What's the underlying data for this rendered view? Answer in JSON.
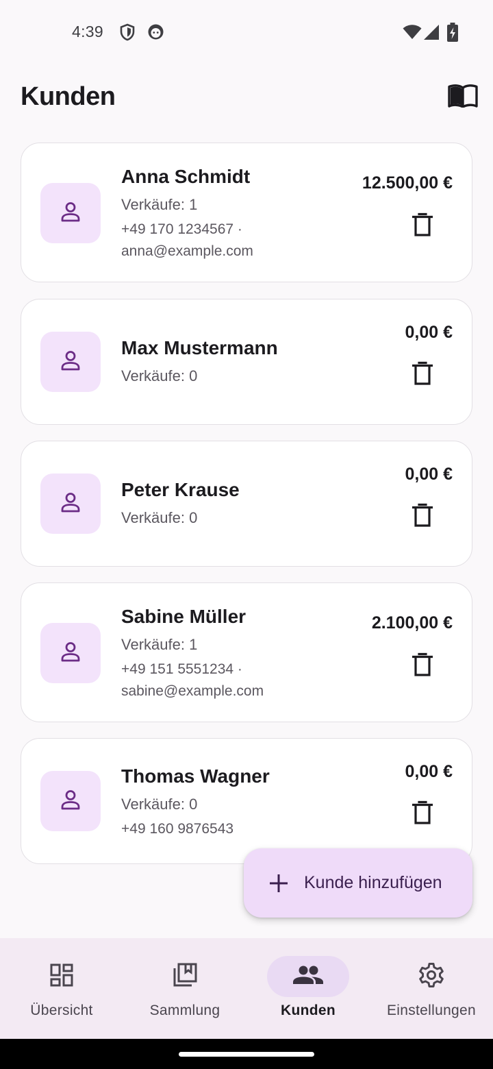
{
  "status_bar": {
    "time": "4:39",
    "left_icons": [
      "shield-icon",
      "face-icon"
    ],
    "right_icons": [
      "wifi-icon",
      "signal-icon",
      "battery-charging-icon"
    ]
  },
  "header": {
    "title": "Kunden",
    "action_icon": "book-icon"
  },
  "customers": [
    {
      "name": "Anna Schmidt",
      "sales": "Verkäufe: 1",
      "contact_line1": "+49 170 1234567 ·",
      "contact_line2": "anna@example.com",
      "amount": "12.500,00 €"
    },
    {
      "name": "Max Mustermann",
      "sales": "Verkäufe: 0",
      "contact_line1": "",
      "contact_line2": "",
      "amount": "0,00 €"
    },
    {
      "name": "Peter Krause",
      "sales": "Verkäufe: 0",
      "contact_line1": "",
      "contact_line2": "",
      "amount": "0,00 €"
    },
    {
      "name": "Sabine Müller",
      "sales": "Verkäufe: 1",
      "contact_line1": "+49 151 5551234 ·",
      "contact_line2": "sabine@example.com",
      "amount": "2.100,00 €"
    },
    {
      "name": "Thomas Wagner",
      "sales": "Verkäufe: 0",
      "contact_line1": "+49 160 9876543",
      "contact_line2": "",
      "amount": "0,00 €"
    }
  ],
  "fab": {
    "label": "Kunde hinzufügen",
    "icon": "plus-icon"
  },
  "nav": {
    "items": [
      {
        "label": "Übersicht",
        "icon": "dashboard-icon",
        "active": false
      },
      {
        "label": "Sammlung",
        "icon": "collection-icon",
        "active": false
      },
      {
        "label": "Kunden",
        "icon": "people-icon",
        "active": true
      },
      {
        "label": "Einstellungen",
        "icon": "settings-icon",
        "active": false
      }
    ]
  },
  "colors": {
    "accent": "#6B2C86",
    "avatar_bg": "#F3E3FB",
    "fab_bg": "#EFDBF9",
    "nav_bg": "#F3EAF3",
    "nav_active_pill": "#E9DAF3"
  }
}
